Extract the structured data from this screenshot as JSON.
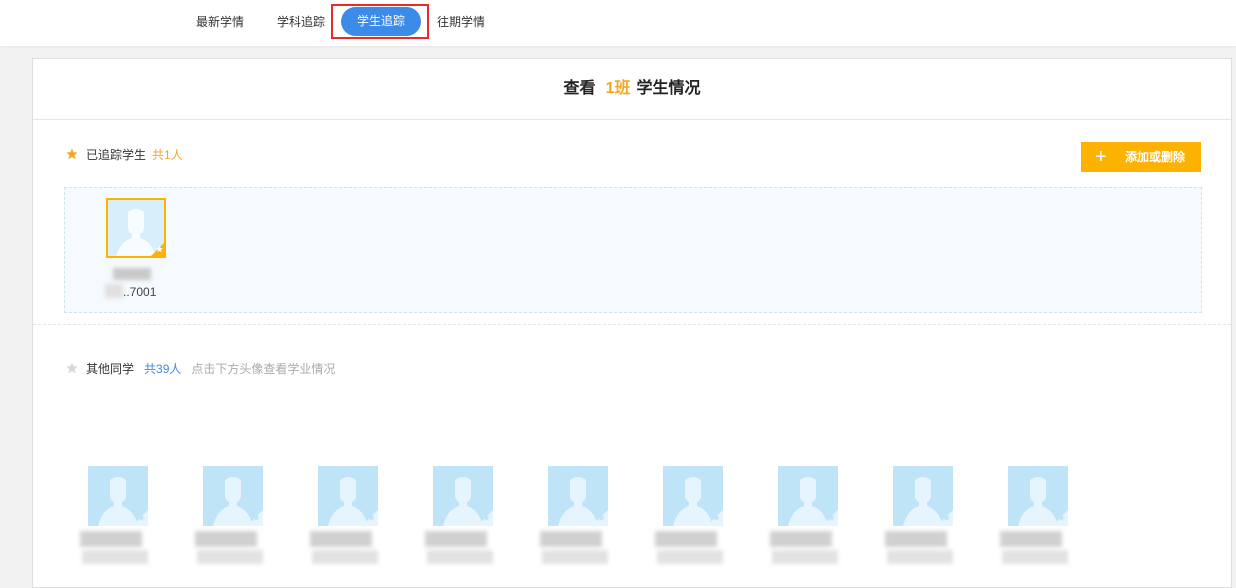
{
  "nav": {
    "tabs": [
      {
        "label": "最新学情"
      },
      {
        "label": "学科追踪"
      },
      {
        "label": "学生追踪"
      },
      {
        "label": "往期学情"
      }
    ]
  },
  "title": {
    "prefix": "查看",
    "class_name": "1班",
    "suffix": "学生情况"
  },
  "tracked": {
    "label": "已追踪学生",
    "count": "共1人",
    "add_button": "添加或删除",
    "students": [
      {
        "id_fragment": "..7001"
      }
    ]
  },
  "others": {
    "label": "其他同学",
    "count": "共39人",
    "hint": "点击下方头像查看学业情况"
  },
  "colors": {
    "accent_blue": "#3d8be8",
    "accent_orange": "#f5a623",
    "button_yellow": "#fdb100",
    "highlight_red": "#e52b2b"
  }
}
